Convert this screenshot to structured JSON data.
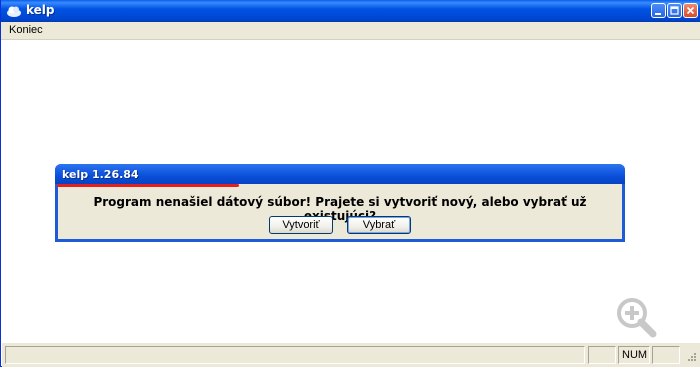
{
  "window": {
    "title": "kelp",
    "icon": "cloud-icon",
    "controls": [
      "minimize-icon",
      "maximize-icon",
      "close-icon"
    ]
  },
  "menu": {
    "items": [
      {
        "label": "Koniec"
      }
    ]
  },
  "dialog": {
    "title": "kelp 1.26.84",
    "message": "Program nenašiel dátový súbor! Prajete si vytvoriť nový, alebo vybrať už existujúci?",
    "buttons": {
      "create": "Vytvoriť",
      "select": "Vybrať"
    },
    "underline_color": "#e32020"
  },
  "statusbar": {
    "main": "",
    "pane1": "",
    "num": "NUM",
    "pane3": ""
  },
  "overlay": {
    "icon": "zoom-in-icon"
  },
  "colors": {
    "titlebar": "#0054e3",
    "face": "#ece9d8",
    "accent_red": "#e32020"
  }
}
